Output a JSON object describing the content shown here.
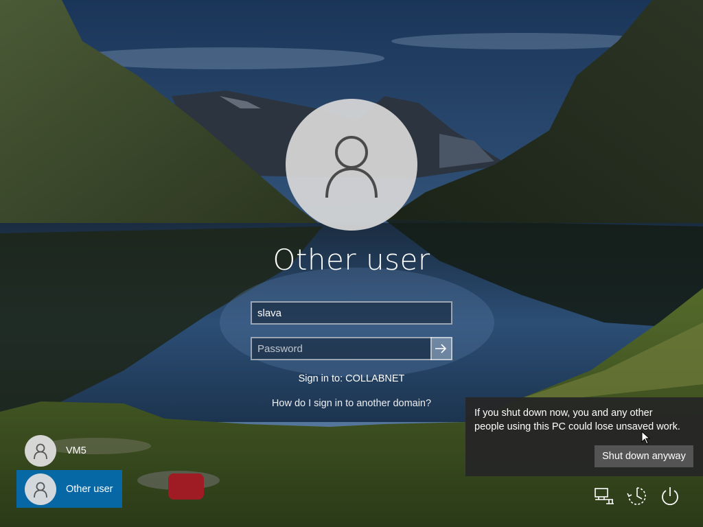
{
  "screen": "Windows sign-in screen",
  "selected_user": {
    "display_name": "Other user",
    "avatar_icon": "user-icon"
  },
  "form": {
    "username_value": "slava",
    "password_placeholder": "Password",
    "submit_icon": "arrow-right-icon",
    "sign_in_to": "Sign in to: COLLABNET",
    "domain_help_link": "How do I sign in to another domain?"
  },
  "user_list": [
    {
      "name": "VM5",
      "selected": false
    },
    {
      "name": "Other user",
      "selected": true
    }
  ],
  "shutdown_warning": {
    "line1": "If you shut down now, you and any other",
    "line2": "people using this PC could lose unsaved work.",
    "button_label": "Shut down anyway"
  },
  "system_icons": [
    "network-icon",
    "ease-of-access-icon",
    "power-icon"
  ],
  "colors": {
    "selected_tile": "#0A6EBE",
    "tooltip_bg": "#262626",
    "button_bg": "#545454"
  }
}
